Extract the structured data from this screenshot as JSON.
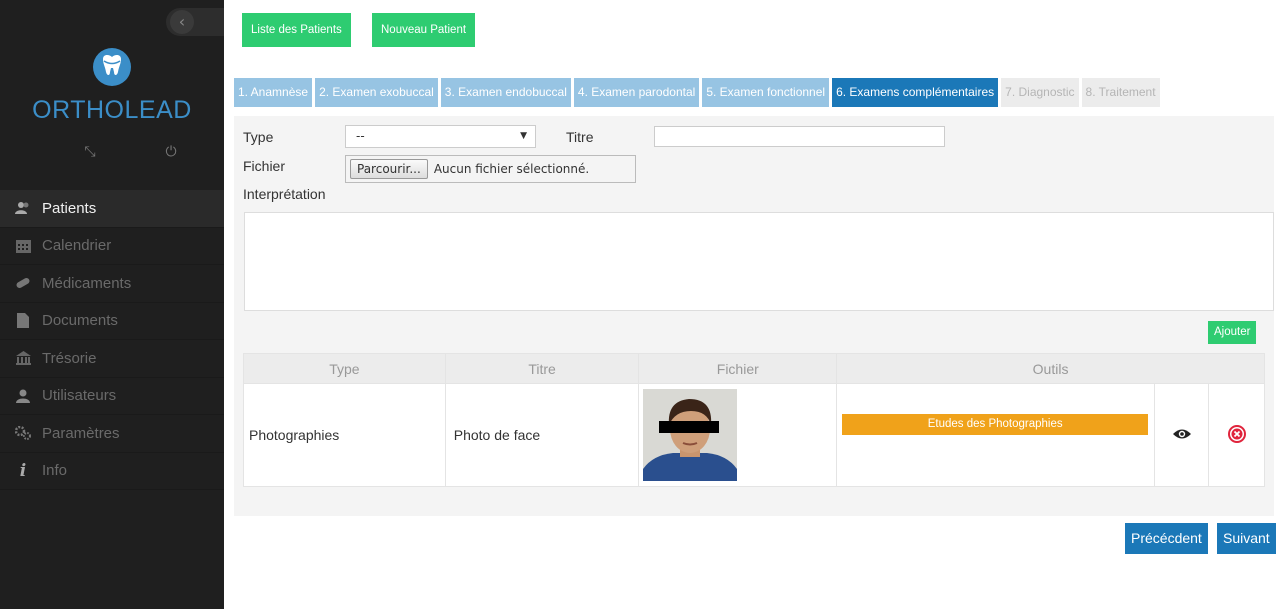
{
  "sidebar": {
    "brand": "ORTHOLEAD",
    "items": [
      {
        "label": "Patients",
        "icon": "users-icon",
        "active": true
      },
      {
        "label": "Calendrier",
        "icon": "calendar-icon"
      },
      {
        "label": "Médicaments",
        "icon": "pill-icon"
      },
      {
        "label": "Documents",
        "icon": "document-icon"
      },
      {
        "label": "Trésorie",
        "icon": "bank-icon"
      },
      {
        "label": "Utilisateurs",
        "icon": "user-icon"
      },
      {
        "label": "Paramètres",
        "icon": "gears-icon"
      },
      {
        "label": "Info",
        "icon": "info-icon"
      }
    ]
  },
  "header": {
    "list_label": "Liste des Patients",
    "new_label": "Nouveau Patient"
  },
  "tabs": [
    {
      "label": "1. Anamnèse",
      "state": "done"
    },
    {
      "label": "2. Examen exobuccal",
      "state": "done"
    },
    {
      "label": "3. Examen endobuccal",
      "state": "done"
    },
    {
      "label": "4. Examen parodontal",
      "state": "done"
    },
    {
      "label": "5. Examen fonctionnel",
      "state": "done"
    },
    {
      "label": "6. Examens complémentaires",
      "state": "active"
    },
    {
      "label": "7. Diagnostic",
      "state": "disabled"
    },
    {
      "label": "8. Traitement",
      "state": "disabled"
    }
  ],
  "form": {
    "type_label": "Type",
    "type_value": "--",
    "titre_label": "Titre",
    "titre_value": "",
    "fichier_label": "Fichier",
    "browse_label": "Parcourir...",
    "file_status": "Aucun fichier sélectionné.",
    "interpretation_label": "Interprétation",
    "add_label": "Ajouter"
  },
  "table": {
    "headers": [
      "Type",
      "Titre",
      "Fichier",
      "Outils"
    ],
    "rows": [
      {
        "type": "Photographies",
        "titre": "Photo de face",
        "tool_label": "Etudes des Photographies"
      }
    ]
  },
  "footer": {
    "prev_label": "Précécdent",
    "next_label": "Suivant"
  },
  "colors": {
    "sidebar_bg": "#1f1f1f",
    "brand": "#3b8ec8",
    "green": "#2ecc71",
    "tab_done": "#97c4e3",
    "tab_active": "#1b78b8",
    "orange": "#f0a21a",
    "danger": "#e0243c"
  }
}
